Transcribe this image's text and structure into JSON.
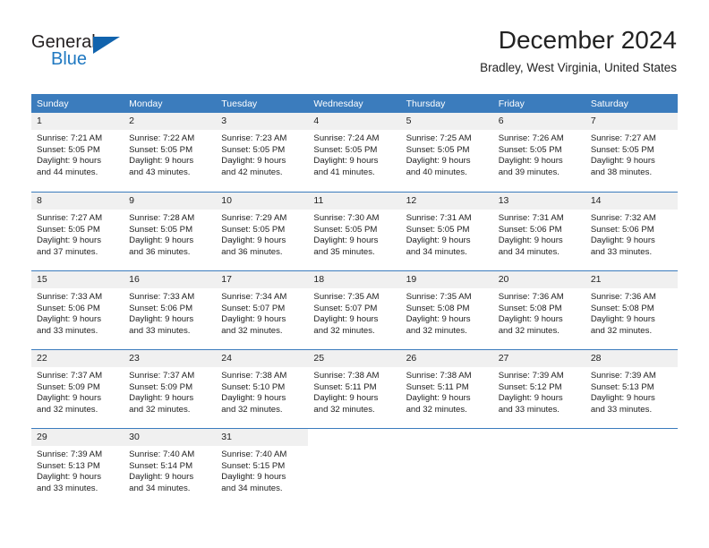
{
  "brand": {
    "name_part1": "General",
    "name_part2": "Blue",
    "logo_icon": "triangle-flag-icon",
    "accent_color": "#1f78c1",
    "header_color": "#3b7cbd"
  },
  "header": {
    "month_title": "December 2024",
    "location": "Bradley, West Virginia, United States"
  },
  "weekdays": [
    "Sunday",
    "Monday",
    "Tuesday",
    "Wednesday",
    "Thursday",
    "Friday",
    "Saturday"
  ],
  "weeks": [
    [
      {
        "day": "1",
        "sunrise": "Sunrise: 7:21 AM",
        "sunset": "Sunset: 5:05 PM",
        "daylight_line1": "Daylight: 9 hours",
        "daylight_line2": "and 44 minutes."
      },
      {
        "day": "2",
        "sunrise": "Sunrise: 7:22 AM",
        "sunset": "Sunset: 5:05 PM",
        "daylight_line1": "Daylight: 9 hours",
        "daylight_line2": "and 43 minutes."
      },
      {
        "day": "3",
        "sunrise": "Sunrise: 7:23 AM",
        "sunset": "Sunset: 5:05 PM",
        "daylight_line1": "Daylight: 9 hours",
        "daylight_line2": "and 42 minutes."
      },
      {
        "day": "4",
        "sunrise": "Sunrise: 7:24 AM",
        "sunset": "Sunset: 5:05 PM",
        "daylight_line1": "Daylight: 9 hours",
        "daylight_line2": "and 41 minutes."
      },
      {
        "day": "5",
        "sunrise": "Sunrise: 7:25 AM",
        "sunset": "Sunset: 5:05 PM",
        "daylight_line1": "Daylight: 9 hours",
        "daylight_line2": "and 40 minutes."
      },
      {
        "day": "6",
        "sunrise": "Sunrise: 7:26 AM",
        "sunset": "Sunset: 5:05 PM",
        "daylight_line1": "Daylight: 9 hours",
        "daylight_line2": "and 39 minutes."
      },
      {
        "day": "7",
        "sunrise": "Sunrise: 7:27 AM",
        "sunset": "Sunset: 5:05 PM",
        "daylight_line1": "Daylight: 9 hours",
        "daylight_line2": "and 38 minutes."
      }
    ],
    [
      {
        "day": "8",
        "sunrise": "Sunrise: 7:27 AM",
        "sunset": "Sunset: 5:05 PM",
        "daylight_line1": "Daylight: 9 hours",
        "daylight_line2": "and 37 minutes."
      },
      {
        "day": "9",
        "sunrise": "Sunrise: 7:28 AM",
        "sunset": "Sunset: 5:05 PM",
        "daylight_line1": "Daylight: 9 hours",
        "daylight_line2": "and 36 minutes."
      },
      {
        "day": "10",
        "sunrise": "Sunrise: 7:29 AM",
        "sunset": "Sunset: 5:05 PM",
        "daylight_line1": "Daylight: 9 hours",
        "daylight_line2": "and 36 minutes."
      },
      {
        "day": "11",
        "sunrise": "Sunrise: 7:30 AM",
        "sunset": "Sunset: 5:05 PM",
        "daylight_line1": "Daylight: 9 hours",
        "daylight_line2": "and 35 minutes."
      },
      {
        "day": "12",
        "sunrise": "Sunrise: 7:31 AM",
        "sunset": "Sunset: 5:05 PM",
        "daylight_line1": "Daylight: 9 hours",
        "daylight_line2": "and 34 minutes."
      },
      {
        "day": "13",
        "sunrise": "Sunrise: 7:31 AM",
        "sunset": "Sunset: 5:06 PM",
        "daylight_line1": "Daylight: 9 hours",
        "daylight_line2": "and 34 minutes."
      },
      {
        "day": "14",
        "sunrise": "Sunrise: 7:32 AM",
        "sunset": "Sunset: 5:06 PM",
        "daylight_line1": "Daylight: 9 hours",
        "daylight_line2": "and 33 minutes."
      }
    ],
    [
      {
        "day": "15",
        "sunrise": "Sunrise: 7:33 AM",
        "sunset": "Sunset: 5:06 PM",
        "daylight_line1": "Daylight: 9 hours",
        "daylight_line2": "and 33 minutes."
      },
      {
        "day": "16",
        "sunrise": "Sunrise: 7:33 AM",
        "sunset": "Sunset: 5:06 PM",
        "daylight_line1": "Daylight: 9 hours",
        "daylight_line2": "and 33 minutes."
      },
      {
        "day": "17",
        "sunrise": "Sunrise: 7:34 AM",
        "sunset": "Sunset: 5:07 PM",
        "daylight_line1": "Daylight: 9 hours",
        "daylight_line2": "and 32 minutes."
      },
      {
        "day": "18",
        "sunrise": "Sunrise: 7:35 AM",
        "sunset": "Sunset: 5:07 PM",
        "daylight_line1": "Daylight: 9 hours",
        "daylight_line2": "and 32 minutes."
      },
      {
        "day": "19",
        "sunrise": "Sunrise: 7:35 AM",
        "sunset": "Sunset: 5:08 PM",
        "daylight_line1": "Daylight: 9 hours",
        "daylight_line2": "and 32 minutes."
      },
      {
        "day": "20",
        "sunrise": "Sunrise: 7:36 AM",
        "sunset": "Sunset: 5:08 PM",
        "daylight_line1": "Daylight: 9 hours",
        "daylight_line2": "and 32 minutes."
      },
      {
        "day": "21",
        "sunrise": "Sunrise: 7:36 AM",
        "sunset": "Sunset: 5:08 PM",
        "daylight_line1": "Daylight: 9 hours",
        "daylight_line2": "and 32 minutes."
      }
    ],
    [
      {
        "day": "22",
        "sunrise": "Sunrise: 7:37 AM",
        "sunset": "Sunset: 5:09 PM",
        "daylight_line1": "Daylight: 9 hours",
        "daylight_line2": "and 32 minutes."
      },
      {
        "day": "23",
        "sunrise": "Sunrise: 7:37 AM",
        "sunset": "Sunset: 5:09 PM",
        "daylight_line1": "Daylight: 9 hours",
        "daylight_line2": "and 32 minutes."
      },
      {
        "day": "24",
        "sunrise": "Sunrise: 7:38 AM",
        "sunset": "Sunset: 5:10 PM",
        "daylight_line1": "Daylight: 9 hours",
        "daylight_line2": "and 32 minutes."
      },
      {
        "day": "25",
        "sunrise": "Sunrise: 7:38 AM",
        "sunset": "Sunset: 5:11 PM",
        "daylight_line1": "Daylight: 9 hours",
        "daylight_line2": "and 32 minutes."
      },
      {
        "day": "26",
        "sunrise": "Sunrise: 7:38 AM",
        "sunset": "Sunset: 5:11 PM",
        "daylight_line1": "Daylight: 9 hours",
        "daylight_line2": "and 32 minutes."
      },
      {
        "day": "27",
        "sunrise": "Sunrise: 7:39 AM",
        "sunset": "Sunset: 5:12 PM",
        "daylight_line1": "Daylight: 9 hours",
        "daylight_line2": "and 33 minutes."
      },
      {
        "day": "28",
        "sunrise": "Sunrise: 7:39 AM",
        "sunset": "Sunset: 5:13 PM",
        "daylight_line1": "Daylight: 9 hours",
        "daylight_line2": "and 33 minutes."
      }
    ],
    [
      {
        "day": "29",
        "sunrise": "Sunrise: 7:39 AM",
        "sunset": "Sunset: 5:13 PM",
        "daylight_line1": "Daylight: 9 hours",
        "daylight_line2": "and 33 minutes."
      },
      {
        "day": "30",
        "sunrise": "Sunrise: 7:40 AM",
        "sunset": "Sunset: 5:14 PM",
        "daylight_line1": "Daylight: 9 hours",
        "daylight_line2": "and 34 minutes."
      },
      {
        "day": "31",
        "sunrise": "Sunrise: 7:40 AM",
        "sunset": "Sunset: 5:15 PM",
        "daylight_line1": "Daylight: 9 hours",
        "daylight_line2": "and 34 minutes."
      },
      {
        "day": "",
        "sunrise": "",
        "sunset": "",
        "daylight_line1": "",
        "daylight_line2": ""
      },
      {
        "day": "",
        "sunrise": "",
        "sunset": "",
        "daylight_line1": "",
        "daylight_line2": ""
      },
      {
        "day": "",
        "sunrise": "",
        "sunset": "",
        "daylight_line1": "",
        "daylight_line2": ""
      },
      {
        "day": "",
        "sunrise": "",
        "sunset": "",
        "daylight_line1": "",
        "daylight_line2": ""
      }
    ]
  ]
}
